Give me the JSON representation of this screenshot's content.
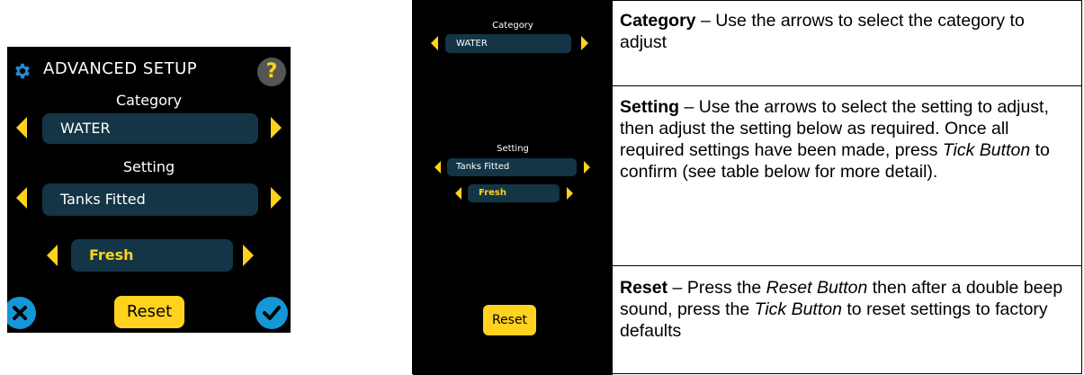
{
  "device": {
    "title": "ADVANCED SETUP",
    "help_label": "?",
    "category_label": "Category",
    "category_value": "WATER",
    "setting_label": "Setting",
    "setting_value": "Tanks Fitted",
    "option_value": "Fresh",
    "reset_label": "Reset",
    "colors": {
      "accent": "#ffd21e",
      "pill": "#133546",
      "action": "#1596d6"
    }
  },
  "table": {
    "rows": [
      {
        "thumb": {
          "label": "Category",
          "value": "WATER"
        },
        "term": "Category",
        "sep": " – ",
        "text": "Use the arrows to select the category to adjust"
      },
      {
        "thumb": {
          "label": "Setting",
          "value": "Tanks Fitted",
          "option": "Fresh"
        },
        "term": "Setting",
        "sep": " – ",
        "text_1": "Use the arrows to select the setting to adjust, then adjust the setting below as required. Once all required settings have been made, press ",
        "em_1": "Tick Button",
        "text_2": " to confirm (see table below for more detail)."
      },
      {
        "thumb": {
          "reset_label": "Reset"
        },
        "term": "Reset",
        "sep": " – ",
        "text_1": "Press the ",
        "em_1": "Reset Button",
        "text_2": " then after a double beep sound, press the ",
        "em_2": "Tick Button",
        "text_3": " to reset settings to factory defaults"
      }
    ]
  }
}
